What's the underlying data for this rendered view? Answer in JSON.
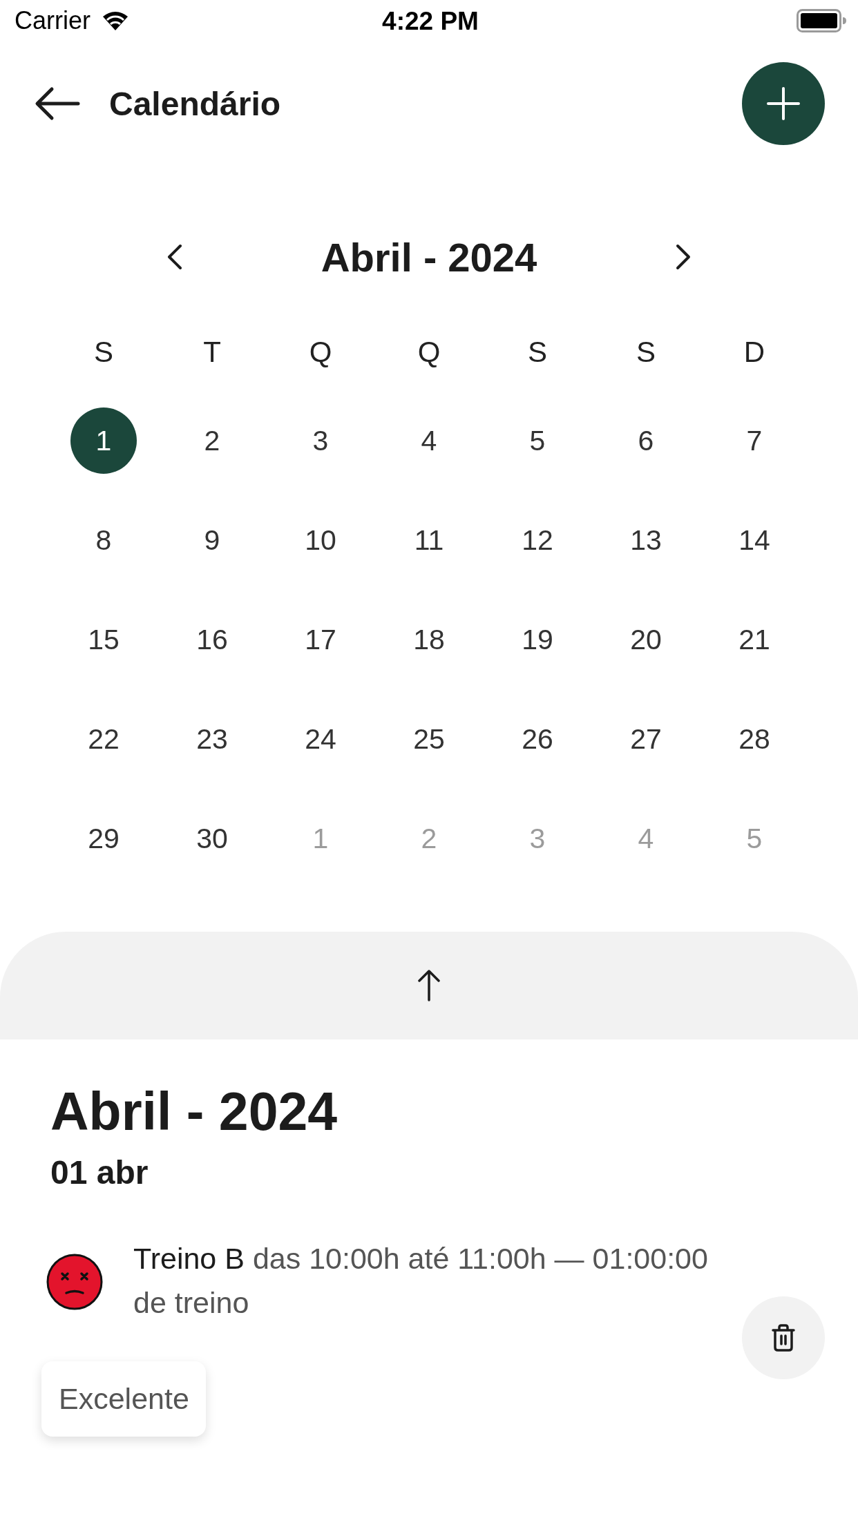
{
  "status_bar": {
    "carrier": "Carrier",
    "time": "4:22 PM"
  },
  "header": {
    "title": "Calendário"
  },
  "calendar": {
    "month": "Abril - 2024",
    "weekdays": [
      "S",
      "T",
      "Q",
      "Q",
      "S",
      "S",
      "D"
    ],
    "days": [
      {
        "day": "1",
        "selected": true,
        "outside_month": false
      },
      {
        "day": "2",
        "selected": false,
        "outside_month": false
      },
      {
        "day": "3",
        "selected": false,
        "outside_month": false
      },
      {
        "day": "4",
        "selected": false,
        "outside_month": false
      },
      {
        "day": "5",
        "selected": false,
        "outside_month": false
      },
      {
        "day": "6",
        "selected": false,
        "outside_month": false
      },
      {
        "day": "7",
        "selected": false,
        "outside_month": false
      },
      {
        "day": "8",
        "selected": false,
        "outside_month": false
      },
      {
        "day": "9",
        "selected": false,
        "outside_month": false
      },
      {
        "day": "10",
        "selected": false,
        "outside_month": false
      },
      {
        "day": "11",
        "selected": false,
        "outside_month": false
      },
      {
        "day": "12",
        "selected": false,
        "outside_month": false
      },
      {
        "day": "13",
        "selected": false,
        "outside_month": false
      },
      {
        "day": "14",
        "selected": false,
        "outside_month": false
      },
      {
        "day": "15",
        "selected": false,
        "outside_month": false
      },
      {
        "day": "16",
        "selected": false,
        "outside_month": false
      },
      {
        "day": "17",
        "selected": false,
        "outside_month": false
      },
      {
        "day": "18",
        "selected": false,
        "outside_month": false
      },
      {
        "day": "19",
        "selected": false,
        "outside_month": false
      },
      {
        "day": "20",
        "selected": false,
        "outside_month": false
      },
      {
        "day": "21",
        "selected": false,
        "outside_month": false
      },
      {
        "day": "22",
        "selected": false,
        "outside_month": false
      },
      {
        "day": "23",
        "selected": false,
        "outside_month": false
      },
      {
        "day": "24",
        "selected": false,
        "outside_month": false
      },
      {
        "day": "25",
        "selected": false,
        "outside_month": false
      },
      {
        "day": "26",
        "selected": false,
        "outside_month": false
      },
      {
        "day": "27",
        "selected": false,
        "outside_month": false
      },
      {
        "day": "28",
        "selected": false,
        "outside_month": false
      },
      {
        "day": "29",
        "selected": false,
        "outside_month": false
      },
      {
        "day": "30",
        "selected": false,
        "outside_month": false
      },
      {
        "day": "1",
        "selected": false,
        "outside_month": true
      },
      {
        "day": "2",
        "selected": false,
        "outside_month": true
      },
      {
        "day": "3",
        "selected": false,
        "outside_month": true
      },
      {
        "day": "4",
        "selected": false,
        "outside_month": true
      },
      {
        "day": "5",
        "selected": false,
        "outside_month": true
      }
    ]
  },
  "agenda": {
    "title": "Abril - 2024",
    "date": "01 abr",
    "events": [
      {
        "title": "Treino B",
        "details": "das 10:00h até 11:00h — 01:00:00 de treino",
        "rating": "Excelente"
      }
    ]
  }
}
